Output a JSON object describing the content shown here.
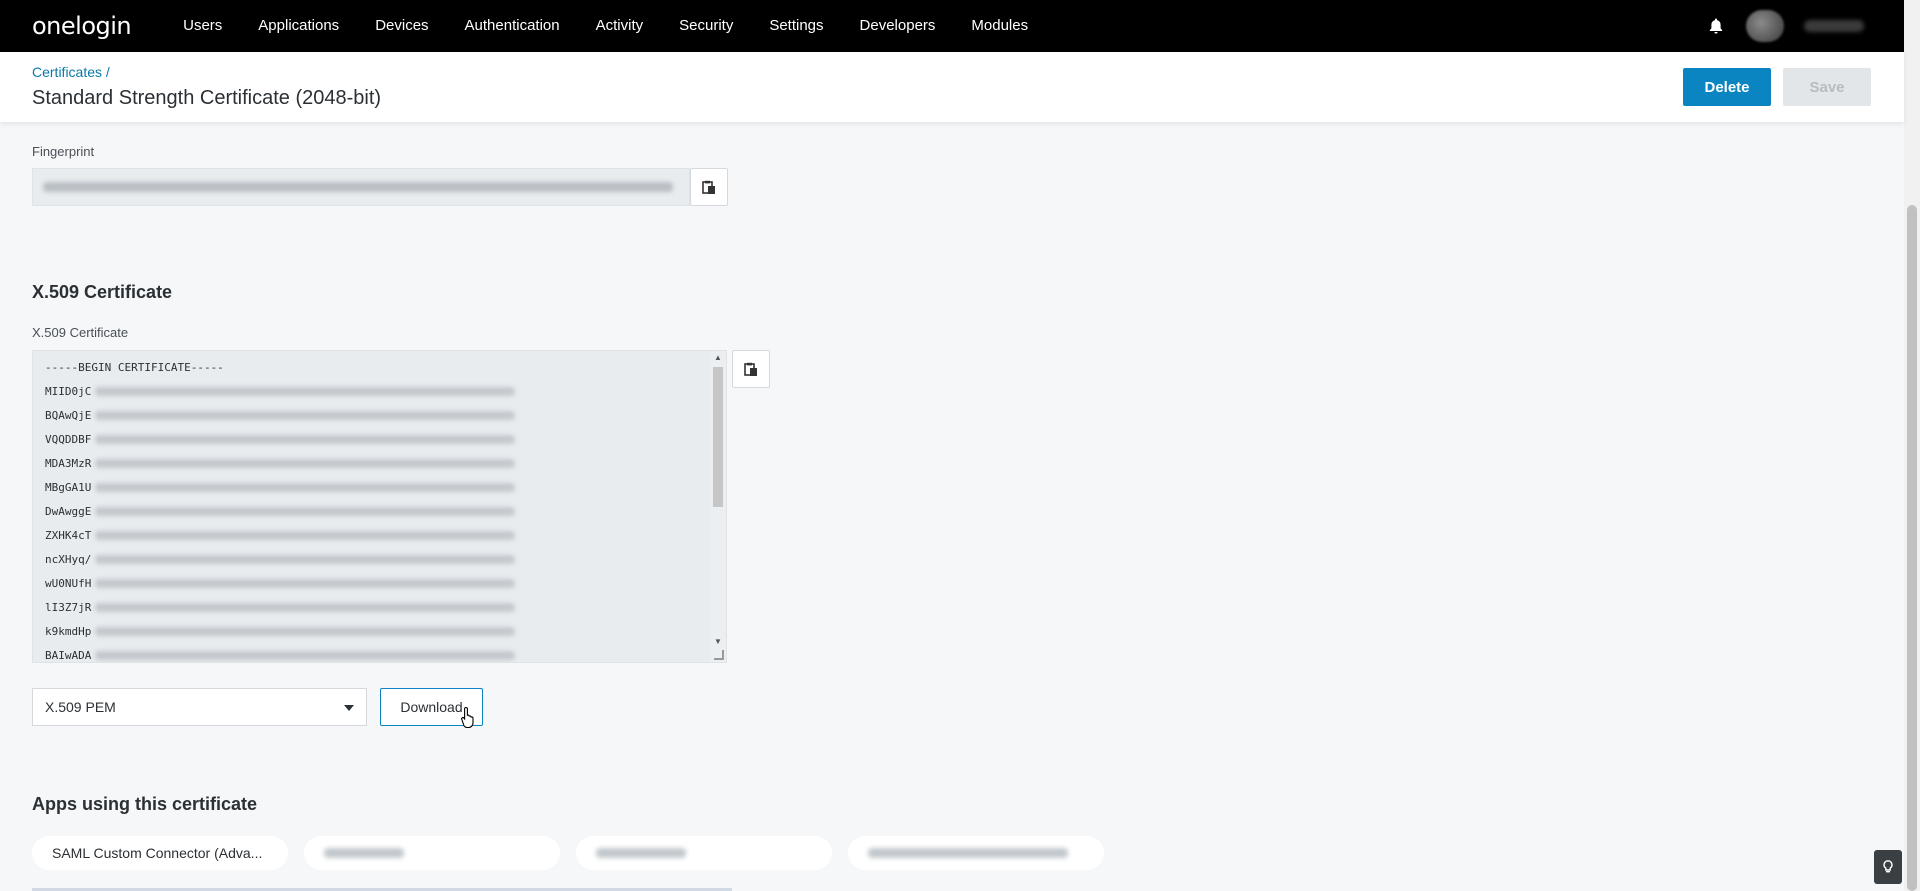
{
  "nav": {
    "logo": "onelogin",
    "items": [
      "Users",
      "Applications",
      "Devices",
      "Authentication",
      "Activity",
      "Security",
      "Settings",
      "Developers",
      "Modules"
    ]
  },
  "header": {
    "breadcrumb": "Certificates /",
    "title": "Standard Strength Certificate (2048-bit)",
    "delete_label": "Delete",
    "save_label": "Save"
  },
  "fingerprint": {
    "label": "Fingerprint"
  },
  "x509": {
    "section_title": "X.509 Certificate",
    "field_label": "X.509 Certificate",
    "lines": [
      "-----BEGIN CERTIFICATE-----",
      "MIID0jC",
      "BQAwQjE",
      "VQQDDBF",
      "MDA3MzR",
      "MBgGA1U",
      "DwAwggE",
      "ZXHK4cT",
      "ncXHyq/",
      "wU0NUfH",
      "lI3Z7jR",
      "k9kmdHp",
      "BAIwADA"
    ],
    "format_selected": "X.509 PEM",
    "download_label": "Download"
  },
  "apps": {
    "section_title": "Apps using this certificate",
    "items": [
      "SAML Custom Connector (Adva..."
    ]
  },
  "colors": {
    "accent": "#0a85c2",
    "nav_bg": "#000000"
  }
}
